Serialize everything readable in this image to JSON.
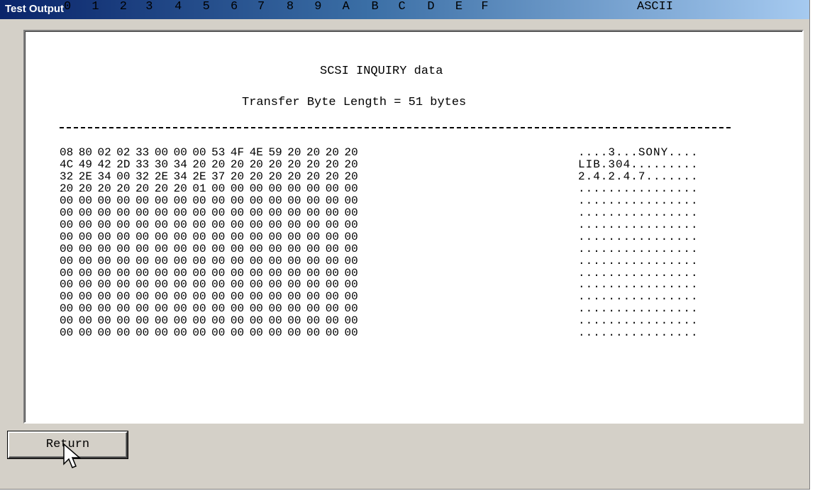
{
  "window": {
    "title": "Test Output"
  },
  "report": {
    "heading": "SCSI INQUIRY data",
    "transfer_length": "Transfer Byte Length = 51 bytes",
    "column_headers": [
      "0",
      "1",
      "2",
      "3",
      "4",
      "5",
      "6",
      "7",
      "8",
      "9",
      "A",
      "B",
      "C",
      "D",
      "E",
      "F"
    ],
    "ascii_header": "ASCII",
    "rows": [
      {
        "hex": [
          "08",
          "80",
          "02",
          "02",
          "33",
          "00",
          "00",
          "00",
          "53",
          "4F",
          "4E",
          "59",
          "20",
          "20",
          "20",
          "20"
        ],
        "ascii": "....3...SONY...."
      },
      {
        "hex": [
          "4C",
          "49",
          "42",
          "2D",
          "33",
          "30",
          "34",
          "20",
          "20",
          "20",
          "20",
          "20",
          "20",
          "20",
          "20",
          "20"
        ],
        "ascii": "LIB.304........."
      },
      {
        "hex": [
          "32",
          "2E",
          "34",
          "00",
          "32",
          "2E",
          "34",
          "2E",
          "37",
          "20",
          "20",
          "20",
          "20",
          "20",
          "20",
          "20"
        ],
        "ascii": "2.4.2.4.7......."
      },
      {
        "hex": [
          "20",
          "20",
          "20",
          "20",
          "20",
          "20",
          "20",
          "01",
          "00",
          "00",
          "00",
          "00",
          "00",
          "00",
          "00",
          "00"
        ],
        "ascii": "................"
      },
      {
        "hex": [
          "00",
          "00",
          "00",
          "00",
          "00",
          "00",
          "00",
          "00",
          "00",
          "00",
          "00",
          "00",
          "00",
          "00",
          "00",
          "00"
        ],
        "ascii": "................"
      },
      {
        "hex": [
          "00",
          "00",
          "00",
          "00",
          "00",
          "00",
          "00",
          "00",
          "00",
          "00",
          "00",
          "00",
          "00",
          "00",
          "00",
          "00"
        ],
        "ascii": "................"
      },
      {
        "hex": [
          "00",
          "00",
          "00",
          "00",
          "00",
          "00",
          "00",
          "00",
          "00",
          "00",
          "00",
          "00",
          "00",
          "00",
          "00",
          "00"
        ],
        "ascii": "................"
      },
      {
        "hex": [
          "00",
          "00",
          "00",
          "00",
          "00",
          "00",
          "00",
          "00",
          "00",
          "00",
          "00",
          "00",
          "00",
          "00",
          "00",
          "00"
        ],
        "ascii": "................"
      },
      {
        "hex": [
          "00",
          "00",
          "00",
          "00",
          "00",
          "00",
          "00",
          "00",
          "00",
          "00",
          "00",
          "00",
          "00",
          "00",
          "00",
          "00"
        ],
        "ascii": "................"
      },
      {
        "hex": [
          "00",
          "00",
          "00",
          "00",
          "00",
          "00",
          "00",
          "00",
          "00",
          "00",
          "00",
          "00",
          "00",
          "00",
          "00",
          "00"
        ],
        "ascii": "................"
      },
      {
        "hex": [
          "00",
          "00",
          "00",
          "00",
          "00",
          "00",
          "00",
          "00",
          "00",
          "00",
          "00",
          "00",
          "00",
          "00",
          "00",
          "00"
        ],
        "ascii": "................"
      },
      {
        "hex": [
          "00",
          "00",
          "00",
          "00",
          "00",
          "00",
          "00",
          "00",
          "00",
          "00",
          "00",
          "00",
          "00",
          "00",
          "00",
          "00"
        ],
        "ascii": "................"
      },
      {
        "hex": [
          "00",
          "00",
          "00",
          "00",
          "00",
          "00",
          "00",
          "00",
          "00",
          "00",
          "00",
          "00",
          "00",
          "00",
          "00",
          "00"
        ],
        "ascii": "................"
      },
      {
        "hex": [
          "00",
          "00",
          "00",
          "00",
          "00",
          "00",
          "00",
          "00",
          "00",
          "00",
          "00",
          "00",
          "00",
          "00",
          "00",
          "00"
        ],
        "ascii": "................"
      },
      {
        "hex": [
          "00",
          "00",
          "00",
          "00",
          "00",
          "00",
          "00",
          "00",
          "00",
          "00",
          "00",
          "00",
          "00",
          "00",
          "00",
          "00"
        ],
        "ascii": "................"
      },
      {
        "hex": [
          "00",
          "00",
          "00",
          "00",
          "00",
          "00",
          "00",
          "00",
          "00",
          "00",
          "00",
          "00",
          "00",
          "00",
          "00",
          "00"
        ],
        "ascii": "................"
      }
    ]
  },
  "buttons": {
    "return_label": "Return"
  },
  "colors": {
    "titlebar_start": "#0a246a",
    "titlebar_end": "#a6caf0",
    "window_bg": "#d4d0c8"
  },
  "icons": {
    "cursor": "arrow-pointer-icon"
  }
}
